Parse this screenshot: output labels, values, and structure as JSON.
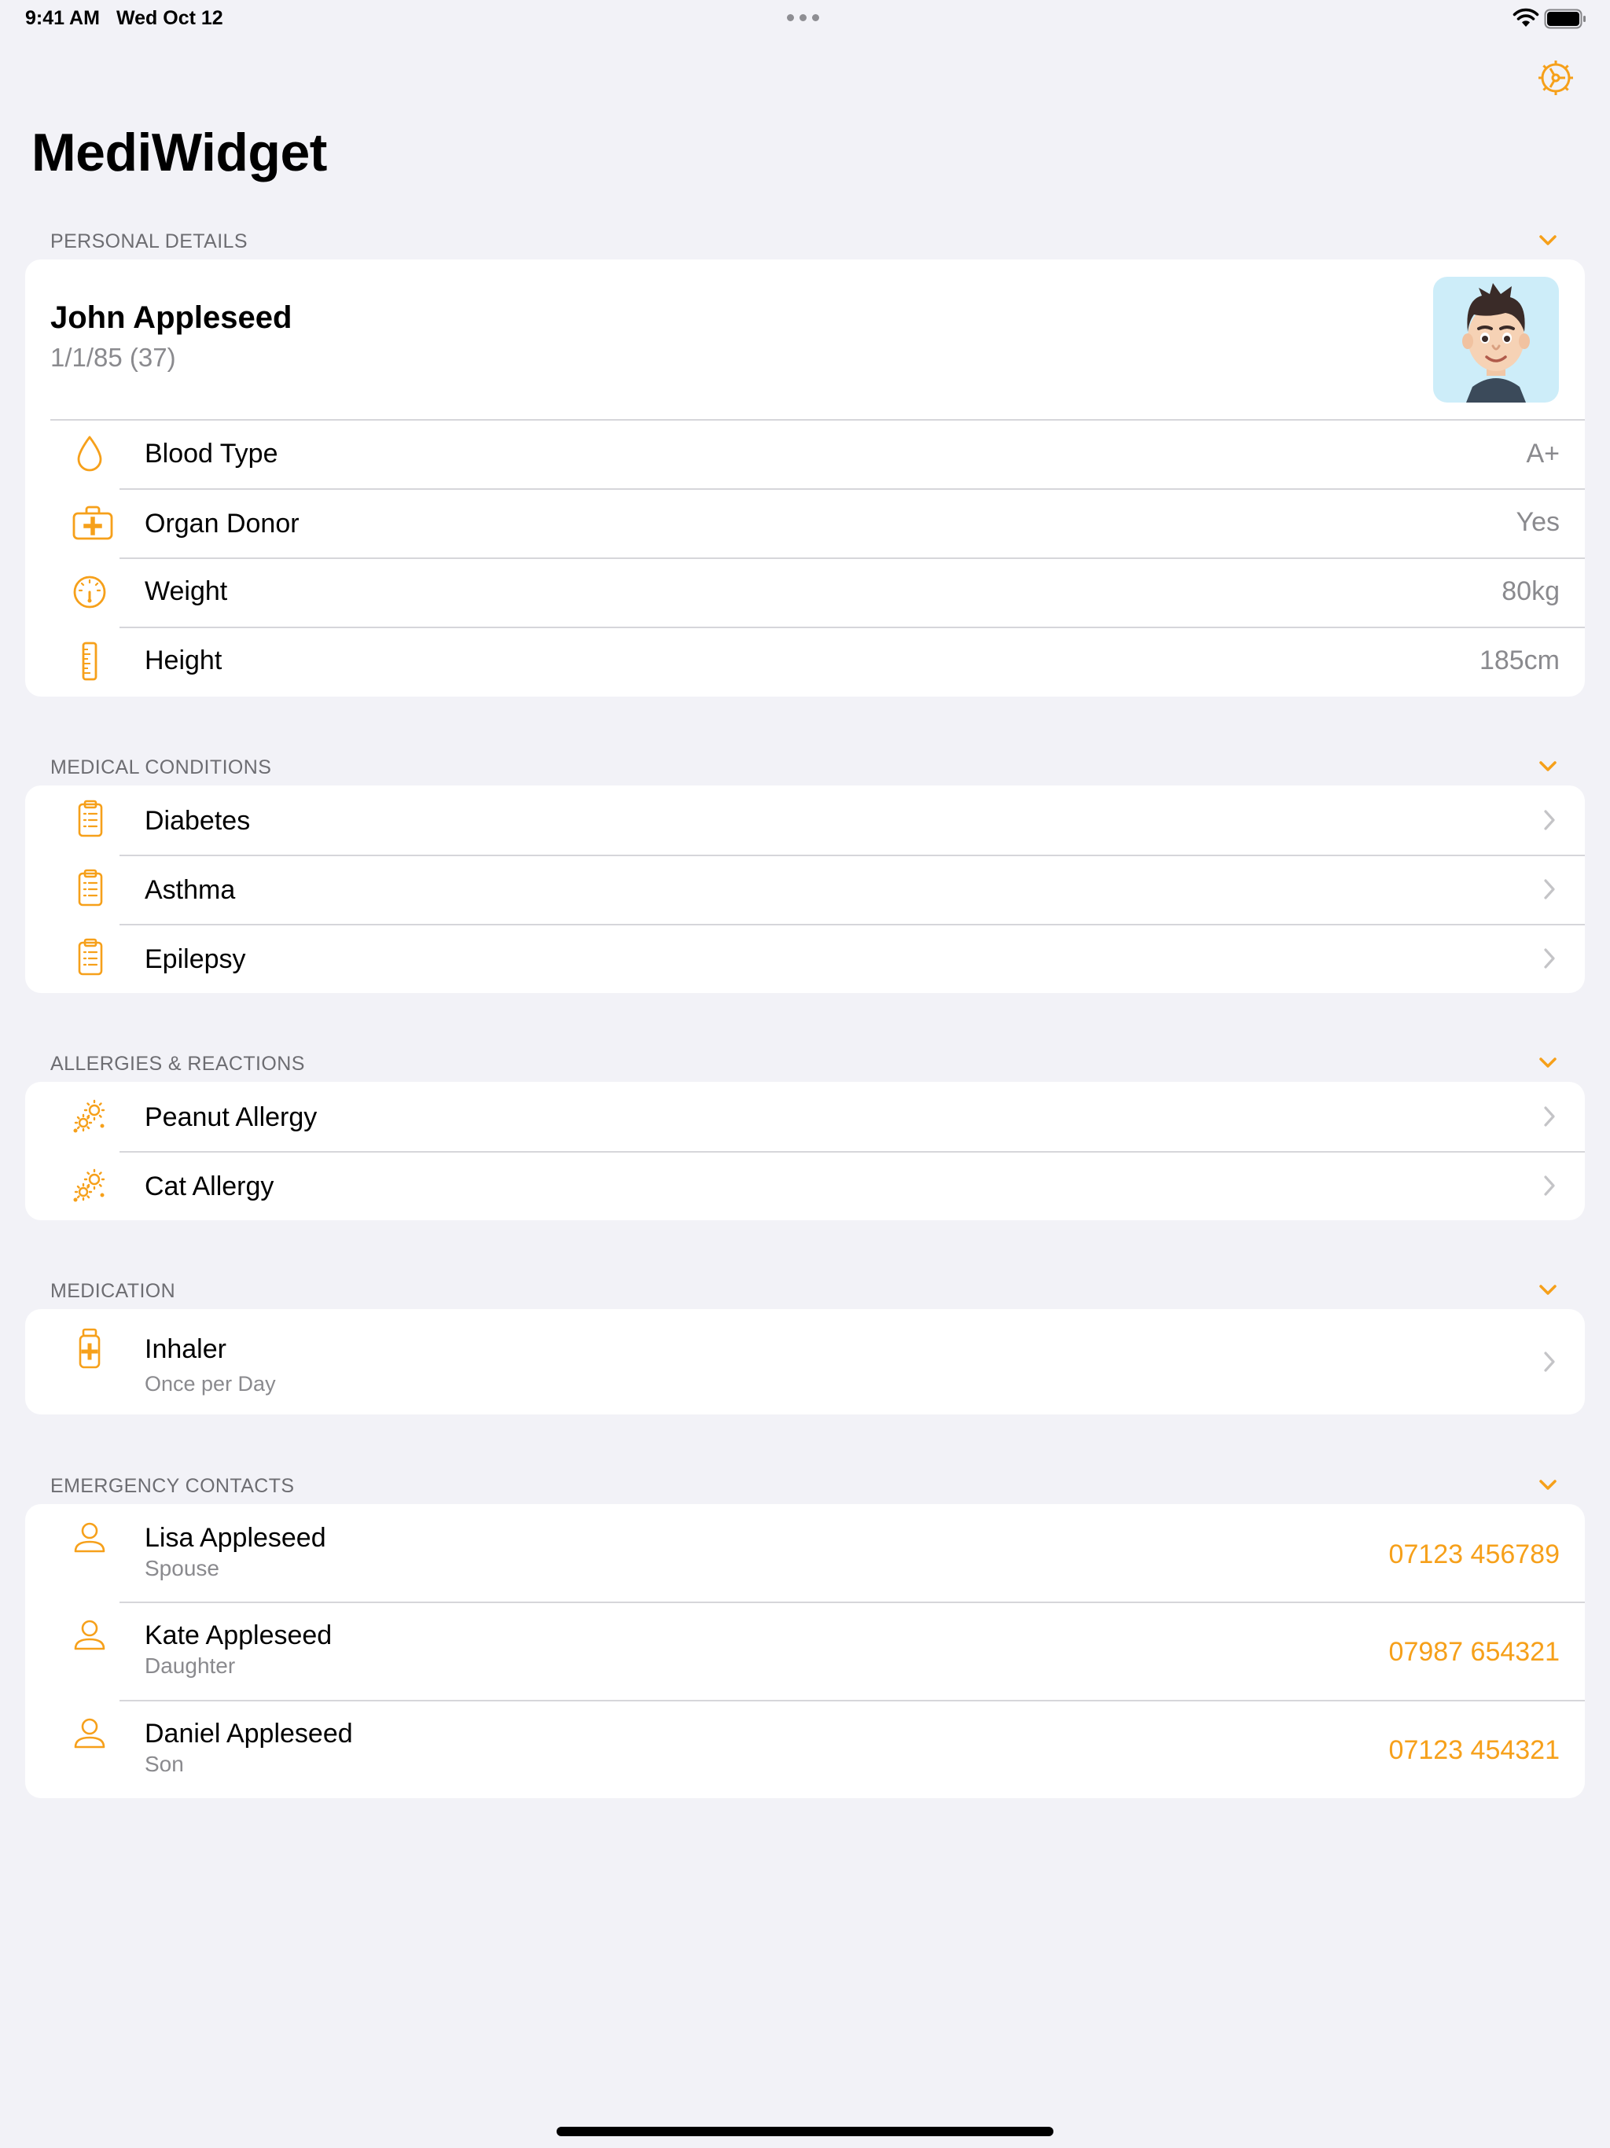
{
  "status_bar": {
    "time": "9:41 AM",
    "date": "Wed Oct 12"
  },
  "app": {
    "title": "MediWidget"
  },
  "colors": {
    "accent": "#F6A01A",
    "background": "#F2F2F7",
    "card": "#FFFFFF",
    "secondary_text": "#8A8A8E"
  },
  "personal": {
    "header": "PERSONAL DETAILS",
    "name": "John Appleseed",
    "dob": "1/1/85 (37)",
    "rows": [
      {
        "icon": "drop-icon",
        "label": "Blood Type",
        "value": "A+"
      },
      {
        "icon": "medical-bag-icon",
        "label": "Organ Donor",
        "value": "Yes"
      },
      {
        "icon": "gauge-icon",
        "label": "Weight",
        "value": "80kg"
      },
      {
        "icon": "ruler-icon",
        "label": "Height",
        "value": "185cm"
      }
    ]
  },
  "conditions": {
    "header": "MEDICAL CONDITIONS",
    "items": [
      {
        "icon": "clipboard-icon",
        "label": "Diabetes"
      },
      {
        "icon": "clipboard-icon",
        "label": "Asthma"
      },
      {
        "icon": "clipboard-icon",
        "label": "Epilepsy"
      }
    ]
  },
  "allergies": {
    "header": "ALLERGIES & REACTIONS",
    "items": [
      {
        "icon": "allergens-icon",
        "label": "Peanut Allergy"
      },
      {
        "icon": "allergens-icon",
        "label": "Cat Allergy"
      }
    ]
  },
  "medication": {
    "header": "MEDICATION",
    "items": [
      {
        "icon": "pill-bottle-icon",
        "label": "Inhaler",
        "detail": "Once per Day"
      }
    ]
  },
  "contacts": {
    "header": "EMERGENCY CONTACTS",
    "items": [
      {
        "icon": "person-icon",
        "name": "Lisa Appleseed",
        "relation": "Spouse",
        "phone": "07123 456789"
      },
      {
        "icon": "person-icon",
        "name": "Kate Appleseed",
        "relation": "Daughter",
        "phone": "07987 654321"
      },
      {
        "icon": "person-icon",
        "name": "Daniel Appleseed",
        "relation": "Son",
        "phone": "07123 454321"
      }
    ]
  }
}
